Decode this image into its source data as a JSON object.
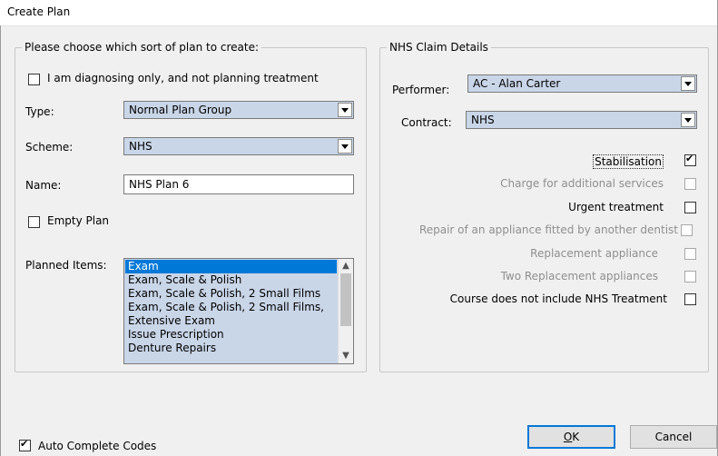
{
  "window": {
    "title": "Create Plan"
  },
  "plan_group": {
    "legend": "Please choose which sort of plan to create:",
    "diagnosing_only": {
      "label": "I am diagnosing only, and not planning treatment",
      "checked": false
    },
    "type": {
      "label": "Type:",
      "value": "Normal Plan Group"
    },
    "scheme": {
      "label": "Scheme:",
      "value": "NHS"
    },
    "name": {
      "label": "Name:",
      "value": "NHS Plan 6"
    },
    "empty_plan": {
      "label": "Empty Plan",
      "checked": false
    },
    "planned_items": {
      "label": "Planned Items:",
      "items": [
        "Exam",
        "Exam, Scale & Polish",
        "Exam, Scale & Polish, 2 Small Films",
        "Exam, Scale & Polish, 2 Small Films,",
        "Extensive Exam",
        "Issue Prescription",
        "Denture Repairs"
      ],
      "selected_index": 0
    }
  },
  "nhs_group": {
    "legend": "NHS Claim Details",
    "performer": {
      "label": "Performer:",
      "value": "AC - Alan Carter"
    },
    "contract": {
      "label": "Contract:",
      "value": "NHS"
    },
    "options": [
      {
        "label": "Stabilisation",
        "checked": true,
        "enabled": true
      },
      {
        "label": "Charge for additional services",
        "checked": false,
        "enabled": false
      },
      {
        "label": "Urgent treatment",
        "checked": false,
        "enabled": true
      },
      {
        "label": "Repair of an appliance fitted by another dentist",
        "checked": false,
        "enabled": false
      },
      {
        "label": "Replacement appliance",
        "checked": false,
        "enabled": false
      },
      {
        "label": "Two Replacement appliances",
        "checked": false,
        "enabled": false
      },
      {
        "label": "Course does not include NHS Treatment",
        "checked": false,
        "enabled": true
      }
    ]
  },
  "footer": {
    "auto_complete": {
      "label": "Auto Complete Codes",
      "checked": true
    },
    "ok_label": "OK",
    "cancel_label": "Cancel"
  }
}
